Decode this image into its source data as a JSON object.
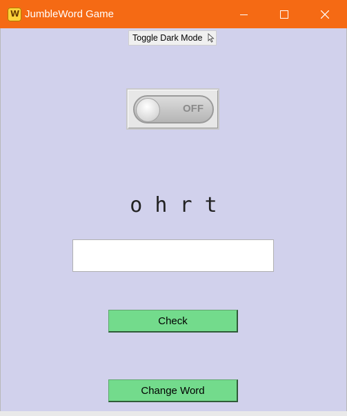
{
  "window": {
    "title": "JumbleWord Game",
    "title_bar_color": "#f56a14"
  },
  "icons": {
    "app": "jumbleword-app-icon",
    "minimize": "minimize-icon",
    "maximize": "maximize-icon",
    "close": "close-icon",
    "cursor": "mouse-pointer-icon"
  },
  "tooltip": {
    "text": "Toggle Dark Mode"
  },
  "dark_mode_toggle": {
    "state_label": "OFF",
    "is_on": false
  },
  "game": {
    "jumbled_word": "o h r t",
    "answer_value": ""
  },
  "buttons": {
    "check_label": "Check",
    "change_word_label": "Change Word",
    "button_color": "#73db8c"
  },
  "colors": {
    "background": "#d1d1ec"
  }
}
